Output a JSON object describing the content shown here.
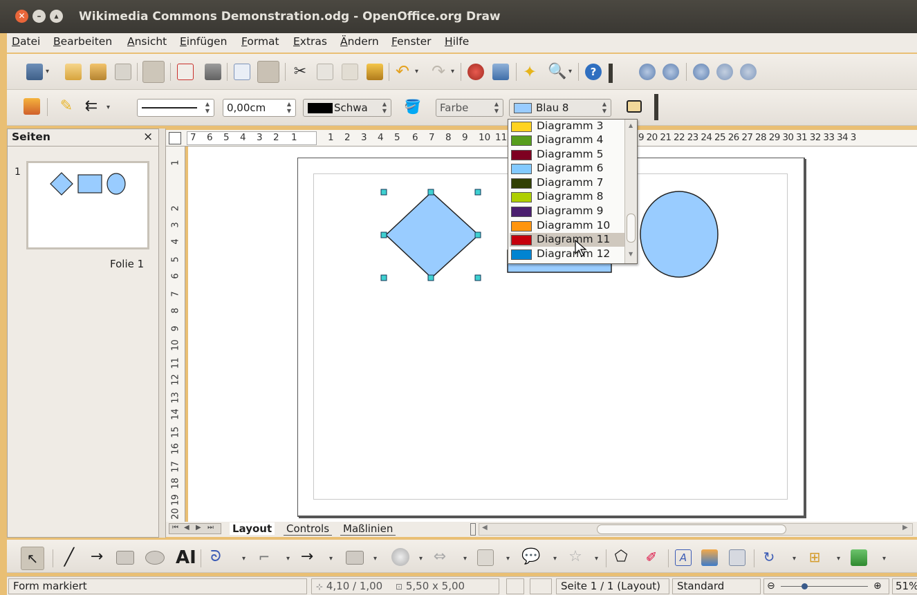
{
  "window": {
    "title": "Wikimedia Commons Demonstration.odg - OpenOffice.org Draw"
  },
  "menu": [
    "Datei",
    "Bearbeiten",
    "Ansicht",
    "Einfügen",
    "Format",
    "Extras",
    "Ändern",
    "Fenster",
    "Hilfe"
  ],
  "line_toolbar": {
    "line_width": "0,00cm",
    "line_color": "Schwa",
    "area_style": "Farbe",
    "area_color": "Blau 8"
  },
  "color_dropdown": {
    "items": [
      {
        "label": "Diagramm 3",
        "color": "#ffd320"
      },
      {
        "label": "Diagramm 4",
        "color": "#579d1c"
      },
      {
        "label": "Diagramm 5",
        "color": "#7e0021"
      },
      {
        "label": "Diagramm 6",
        "color": "#83caff"
      },
      {
        "label": "Diagramm 7",
        "color": "#314004"
      },
      {
        "label": "Diagramm 8",
        "color": "#aecf00"
      },
      {
        "label": "Diagramm 9",
        "color": "#4b1f6f"
      },
      {
        "label": "Diagramm 10",
        "color": "#ff950e"
      },
      {
        "label": "Diagramm 11",
        "color": "#c5000b"
      },
      {
        "label": "Diagramm 12",
        "color": "#0084d1"
      }
    ],
    "highlighted": "Diagramm 11"
  },
  "pages_panel": {
    "title": "Seiten",
    "close": "×",
    "page_number": "1",
    "page_label": "Folie 1"
  },
  "hruler_left": [
    "7",
    "6",
    "5",
    "4",
    "3",
    "2",
    "1"
  ],
  "hruler_right": [
    "1",
    "2",
    "3",
    "4",
    "5",
    "6",
    "7",
    "8",
    "9",
    "10",
    "11"
  ],
  "hruler_far": "9 20 21 22 23 24 25 26 27 28 29 30 31 32 33 34 3",
  "vruler": [
    "1",
    "2",
    "3",
    "4",
    "5",
    "6",
    "7",
    "8",
    "9",
    "10",
    "11",
    "12",
    "13",
    "14",
    "15",
    "16",
    "17",
    "18",
    "19",
    "20"
  ],
  "tabs": [
    "Layout",
    "Controls",
    "Maßlinien"
  ],
  "status": {
    "message": "Form markiert",
    "position": "4,10 / 1,00",
    "size": "5,50 x 5,00",
    "page": "Seite 1 / 1 (Layout)",
    "style": "Standard",
    "zoom": "51%"
  },
  "colors": {
    "shape_fill": "#99ccff",
    "handle": "#3fd0d0",
    "accent": "#e0673a"
  }
}
